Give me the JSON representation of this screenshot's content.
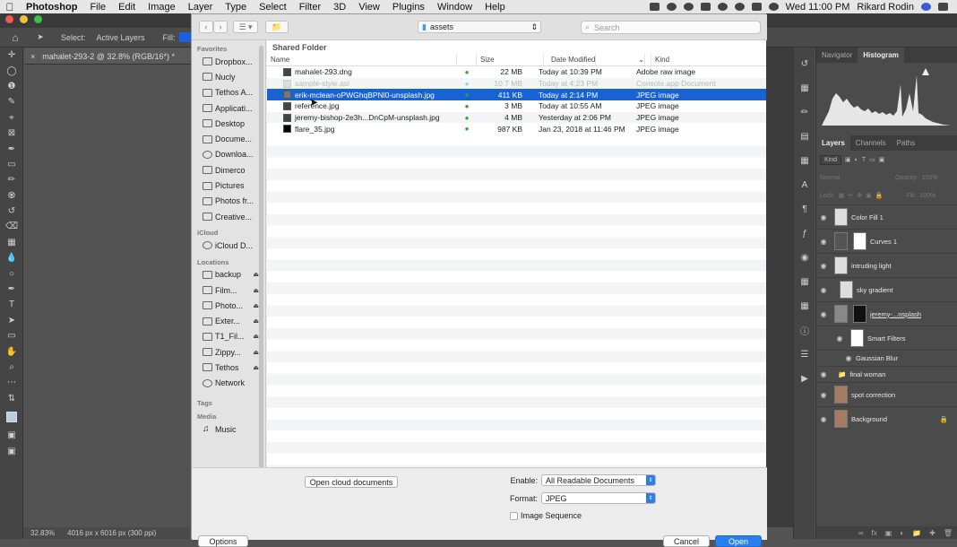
{
  "menubar": {
    "apple": "",
    "items": [
      "Photoshop",
      "File",
      "Edit",
      "Image",
      "Layer",
      "Type",
      "Select",
      "Filter",
      "3D",
      "View",
      "Plugins",
      "Window",
      "Help"
    ],
    "clock": "Wed 11:00 PM",
    "user": "Rikard Rodin"
  },
  "options_bar": {
    "select_label": "Select:",
    "select_value": "Active Layers",
    "fill_label": "Fill:"
  },
  "document_tab": {
    "title": "mahalet-293-2 @ 32.8% (RGB/16*) *",
    "close": "×"
  },
  "status_bar": {
    "zoom": "32.83%",
    "info": "4016 px x 6016 px (300 ppi)"
  },
  "right_panel": {
    "top_tabs": [
      "Navigator",
      "Histogram"
    ],
    "layer_tabs": [
      "Layers",
      "Channels",
      "Paths"
    ],
    "kind_label": "Kind",
    "blend_mode": "Normal",
    "opacity_label": "Opacity:",
    "opacity_value": "100%",
    "lock_label": "Lock:",
    "fill_label": "Fill:",
    "fill_value": "100%",
    "layers": [
      {
        "name": "Color Fill 1"
      },
      {
        "name": "Curves 1"
      },
      {
        "name": "intruding light"
      },
      {
        "name": "sky gradient"
      },
      {
        "name": "jeremy-...nsplash"
      },
      {
        "name": "Smart Filters"
      },
      {
        "name": "Gaussian Blur"
      },
      {
        "name": "final woman"
      },
      {
        "name": "spot correction"
      },
      {
        "name": "Background"
      }
    ]
  },
  "dialog": {
    "folder": "assets",
    "search_placeholder": "Search",
    "sidebar": {
      "favorites_label": "Favorites",
      "favorites": [
        "Dropbox...",
        "Nucly",
        "Tethos A...",
        "Applicati...",
        "Desktop",
        "Docume...",
        "Downloa...",
        "Dimerco",
        "Pictures",
        "Photos fr...",
        "Creative..."
      ],
      "icloud_label": "iCloud",
      "icloud": [
        "iCloud D..."
      ],
      "locations_label": "Locations",
      "locations": [
        "backup",
        "Film...",
        "Photo...",
        "Exter...",
        "T1_Fil...",
        "Zippy...",
        "Tethos",
        "Network"
      ],
      "tags_label": "Tags",
      "media_label": "Media",
      "media": [
        "Music"
      ]
    },
    "location_title": "Shared Folder",
    "columns": {
      "name": "Name",
      "size": "Size",
      "date": "Date Modified",
      "kind": "Kind"
    },
    "files": [
      {
        "name": "mahalet-293.dng",
        "size": "22 MB",
        "date": "Today at 10:39 PM",
        "kind": "Adobe raw image"
      },
      {
        "name": "sample-style.asl",
        "size": "10.7 MB",
        "date": "Today at 4:23 PM",
        "kind": "Console.app Document"
      },
      {
        "name": "erik-mclean-oPWGhqBPNl0-unsplash.jpg",
        "size": "411 KB",
        "date": "Today at 2:14 PM",
        "kind": "JPEG image"
      },
      {
        "name": "reference.jpg",
        "size": "3 MB",
        "date": "Today at 10:55 AM",
        "kind": "JPEG image"
      },
      {
        "name": "jeremy-bishop-2e3h...DnCpM-unsplash.jpg",
        "size": "4 MB",
        "date": "Yesterday at 2:06 PM",
        "kind": "JPEG image"
      },
      {
        "name": "flare_35.jpg",
        "size": "987 KB",
        "date": "Jan 23, 2018 at 11:46 PM",
        "kind": "JPEG image"
      }
    ],
    "open_cloud": "Open cloud documents",
    "enable_label": "Enable:",
    "enable_value": "All Readable Documents",
    "format_label": "Format:",
    "format_value": "JPEG",
    "image_sequence": "Image Sequence",
    "options_btn": "Options",
    "cancel_btn": "Cancel",
    "open_btn": "Open"
  },
  "colors": {
    "selection": "#1863d3",
    "accent": "#2a7ff0",
    "check": "#22aa33"
  }
}
